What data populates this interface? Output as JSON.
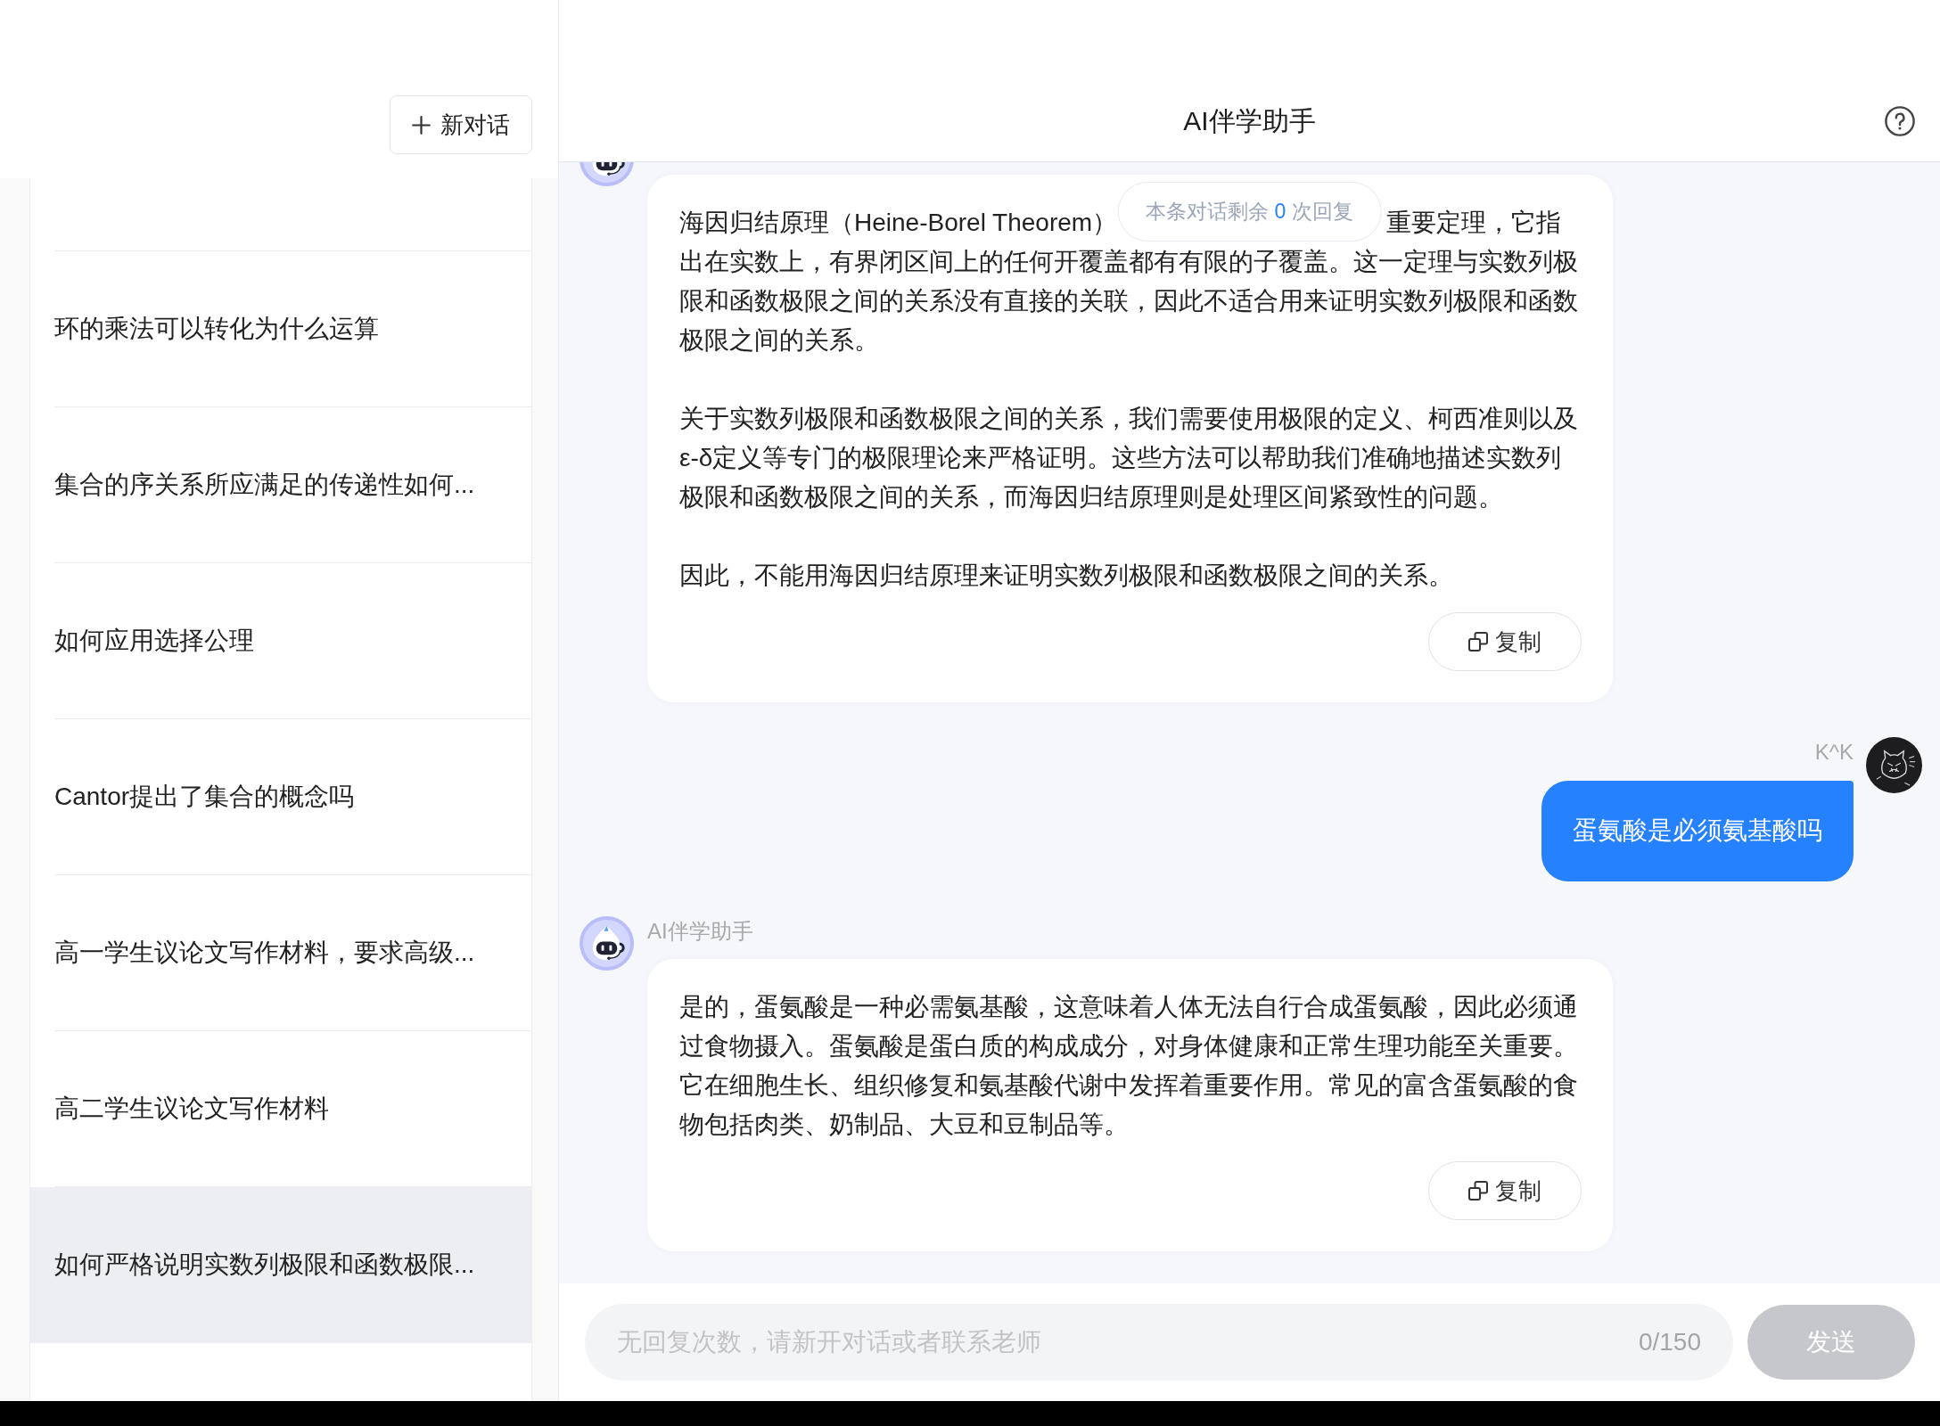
{
  "sidebar": {
    "new_chat_button": {
      "label": "新对话"
    },
    "items": [
      {
        "label": "环的乘法可以转化为什么运算",
        "selected": false
      },
      {
        "label": "集合的序关系所应满足的传递性如何...",
        "selected": false
      },
      {
        "label": "如何应用选择公理",
        "selected": false
      },
      {
        "label": "Cantor提出了集合的概念吗",
        "selected": false
      },
      {
        "label": "高一学生议论文写作材料，要求高级...",
        "selected": false
      },
      {
        "label": "高二学生议论文写作材料",
        "selected": false
      },
      {
        "label": "如何严格说明实数列极限和函数极限...",
        "selected": true
      }
    ]
  },
  "chat": {
    "title": "AI伴学助手",
    "notice": {
      "before": "本条对话剩余 ",
      "count": "0",
      "after": " 次回复"
    },
    "messages": [
      {
        "kind": "assistant",
        "paragraphs": [
          {
            "kind": "covered",
            "visible_left": "海因归结原理（Heine-Borel Theorem）",
            "visible_right": "重要定理，它指",
            "rest": "出在实数上，有界闭区间上的任何开覆盖都有有限的子覆盖。这一定理与实数列极限和函数极限之间的关系没有直接的关联，因此不适合用来证明实数列极限和函数极限之间的关系。"
          },
          {
            "kind": "plain",
            "text": "关于实数列极限和函数极限之间的关系，我们需要使用极限的定义、柯西准则以及ε-δ定义等专门的极限理论来严格证明。这些方法可以帮助我们准确地描述实数列极限和函数极限之间的关系，而海因归结原理则是处理区间紧致性的问题。"
          },
          {
            "kind": "plain",
            "text": "因此，不能用海因归结原理来证明实数列极限和函数极限之间的关系。"
          }
        ],
        "copy_button": "复制"
      },
      {
        "kind": "user",
        "sender": "K^K",
        "text": "蛋氨酸是必须氨基酸吗"
      },
      {
        "kind": "assistant",
        "sender": "AI伴学助手",
        "paragraphs": [
          {
            "kind": "plain",
            "text": "是的，蛋氨酸是一种必需氨基酸，这意味着人体无法自行合成蛋氨酸，因此必须通过食物摄入。蛋氨酸是蛋白质的构成成分，对身体健康和正常生理功能至关重要。它在细胞生长、组织修复和氨基酸代谢中发挥着重要作用。常见的富含蛋氨酸的食物包括肉类、奶制品、大豆和豆制品等。"
          }
        ],
        "copy_button": "复制"
      }
    ]
  },
  "input_bar": {
    "placeholder": "无回复次数，请新开对话或者联系老师",
    "counter": "0/150",
    "send_button": {
      "label": "发送",
      "disabled": true
    }
  }
}
